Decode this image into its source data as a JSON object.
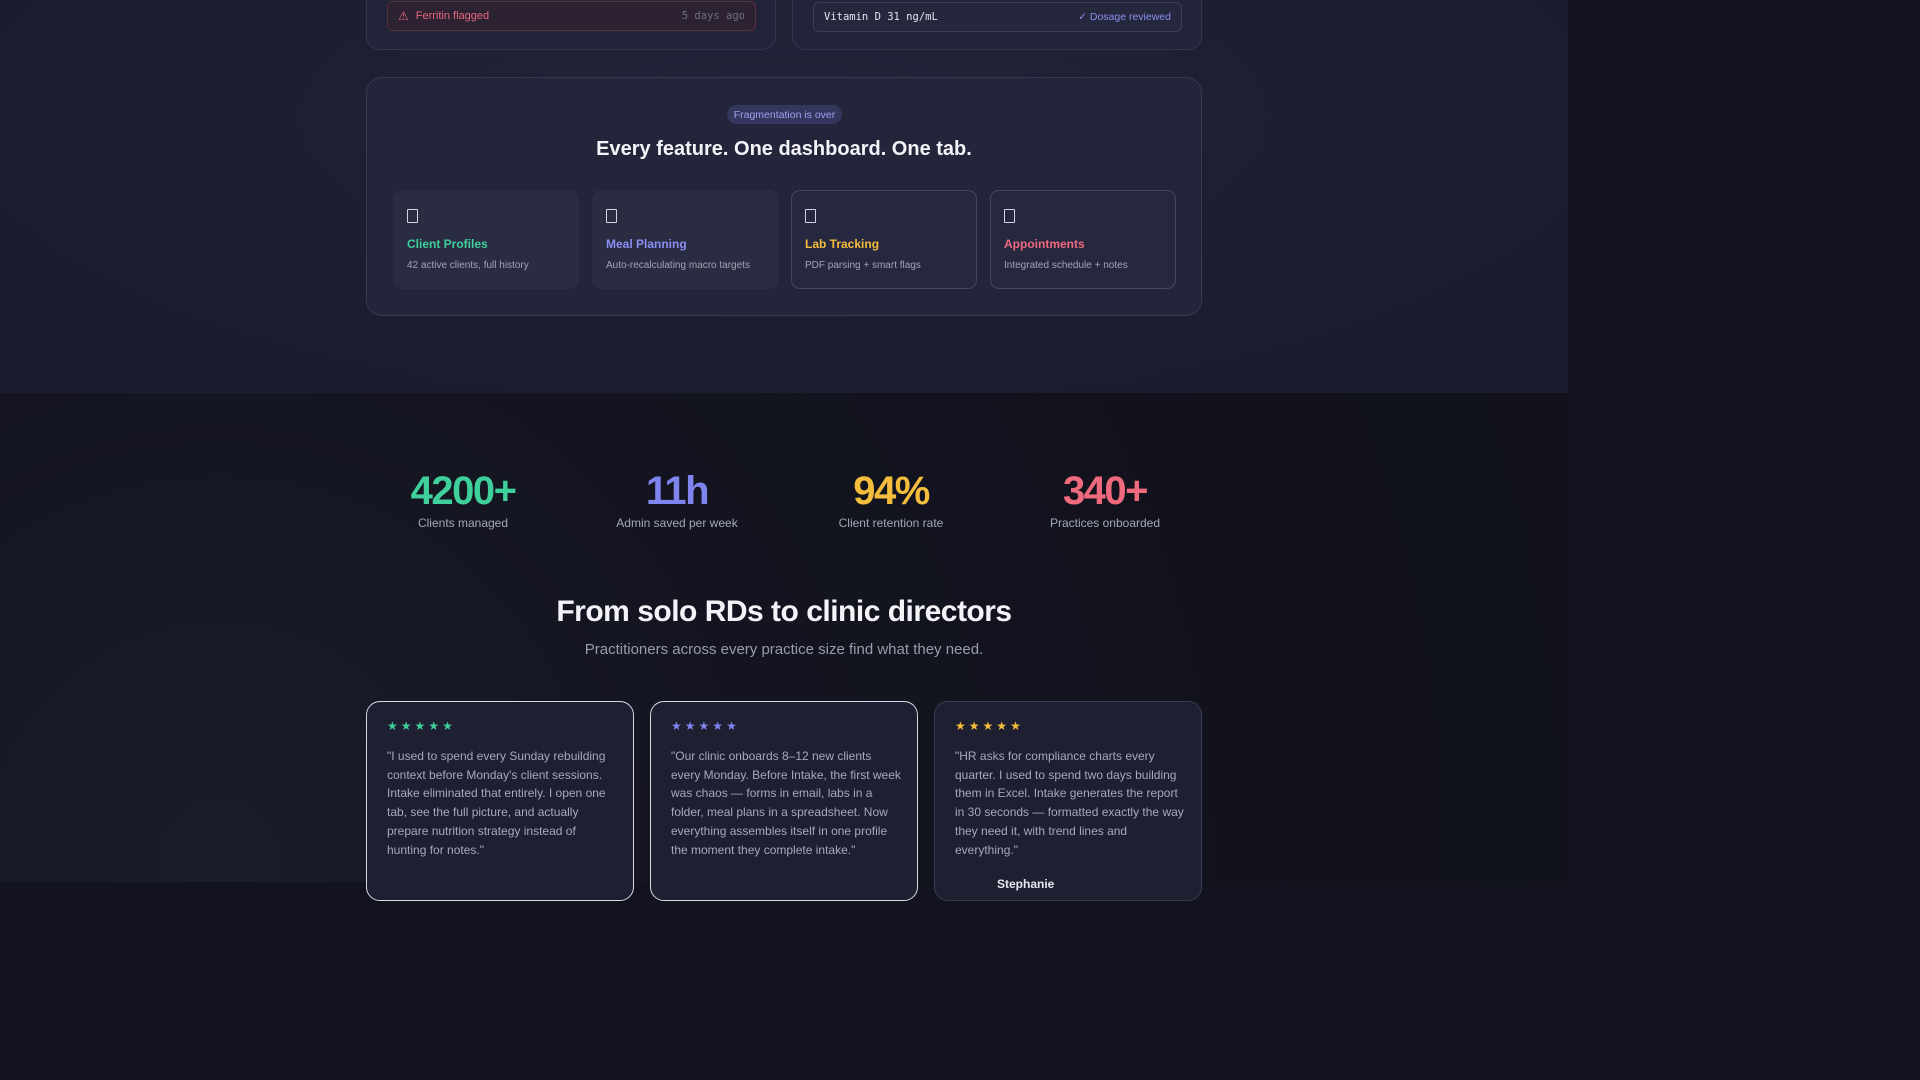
{
  "top_cards": {
    "left": {
      "alert_icon": "warning-icon",
      "alert_label": "Ferritin flagged",
      "alert_time": "5 days ago"
    },
    "right": {
      "value": "Vitamin D 31 ng/mL",
      "status": "✓ Dosage reviewed"
    }
  },
  "features": {
    "pill": "Fragmentation is over",
    "title": "Every feature. One dashboard. One tab.",
    "items": [
      {
        "icon": "document-icon",
        "title": "Client Profiles",
        "desc": "42 active clients, full history",
        "color": "#3ecf9a"
      },
      {
        "icon": "document-icon",
        "title": "Meal Planning",
        "desc": "Auto-recalculating macro targets",
        "color": "#8a8ef2"
      },
      {
        "icon": "document-icon",
        "title": "Lab Tracking",
        "desc": "PDF parsing + smart flags",
        "color": "#f5bd3c"
      },
      {
        "icon": "document-icon",
        "title": "Appointments",
        "desc": "Integrated schedule + notes",
        "color": "#f06a7e"
      }
    ]
  },
  "stats": [
    {
      "value": "4200+",
      "label": "Clients managed",
      "color": "#3ecf9a"
    },
    {
      "value": "11h",
      "label": "Admin saved per week",
      "color": "#7f84ef"
    },
    {
      "value": "94%",
      "label": "Client retention rate",
      "color": "#f5bd3c"
    },
    {
      "value": "340+",
      "label": "Practices onboarded",
      "color": "#f06a7e"
    }
  ],
  "testimonials_section": {
    "title": "From solo RDs to clinic directors",
    "subtitle": "Practitioners across every practice size find what they need."
  },
  "testimonials": [
    {
      "stars": 5,
      "star_color": "#3ecf9a",
      "quote": "\"I used to spend every Sunday rebuilding context before Monday's client sessions. Intake eliminated that entirely. I open one tab, see the full picture, and actually prepare nutrition strategy instead of hunting for notes.\""
    },
    {
      "stars": 5,
      "star_color": "#7f84ef",
      "quote": "\"Our clinic onboards 8–12 new clients every Monday. Before Intake, the first week was chaos — forms in email, labs in a folder, meal plans in a spreadsheet. Now everything assembles itself in one profile the moment they complete intake.\""
    },
    {
      "stars": 5,
      "star_color": "#f5bd3c",
      "quote": "\"HR asks for compliance charts every quarter. I used to spend two days building them in Excel. Intake generates the report in 30 seconds — formatted exactly the way they need it, with trend lines and everything.\"",
      "author": "Stephanie"
    }
  ]
}
